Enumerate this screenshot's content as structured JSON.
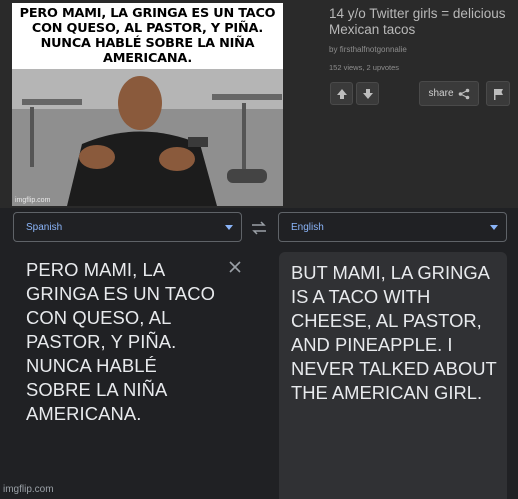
{
  "meme": {
    "caption": "PERO MAMI, LA GRINGA ES UN TACO CON QUESO, AL PASTOR, Y PIÑA. NUNCA HABLÉ SOBRE LA NIÑA AMERICANA.",
    "watermark": "imgflip.com"
  },
  "post": {
    "title": "14 y/o Twitter girls = delicious Mexican tacos",
    "byline_prefix": "by",
    "author": "firsthalfnotgonnalie",
    "stats": "152 views, 2 upvotes",
    "share_label": "share"
  },
  "translate": {
    "source_lang": "Spanish",
    "target_lang": "English",
    "source_text": "PERO MAMI, LA GRINGA ES UN TACO CON QUESO, AL PASTOR, Y PIÑA. NUNCA HABLÉ SOBRE LA NIÑA AMERICANA.",
    "target_text": "BUT MAMI, LA GRINGA IS A TACO WITH CHEESE, AL PASTOR, AND PINEAPPLE. I NEVER TALKED ABOUT THE AMERICAN GIRL."
  },
  "footer": {
    "watermark": "imgflip.com"
  },
  "colors": {
    "accent": "#8ab4f8",
    "panel": "#303134",
    "background": "#202124"
  }
}
